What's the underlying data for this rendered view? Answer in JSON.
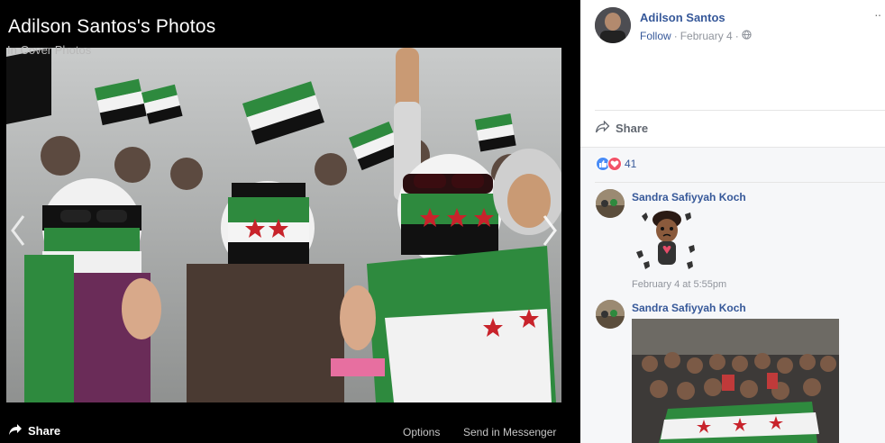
{
  "viewer": {
    "title": "Adilson Santos's Photos",
    "album": "In Cover Photos",
    "share_label": "Share",
    "options_label": "Options",
    "messenger_label": "Send in Messenger"
  },
  "post": {
    "owner_name": "Adilson Santos",
    "follow_label": "Follow",
    "separator": "·",
    "date": "February 4",
    "privacy_icon": "globe-icon",
    "more_label": "··",
    "share_label": "Share",
    "reaction_count": "41",
    "reaction_icons": [
      "like-icon",
      "love-icon"
    ]
  },
  "comments": [
    {
      "author": "Sandra Safiyyah Koch",
      "type": "sticker",
      "timestamp": "February 4 at 5:55pm"
    },
    {
      "author": "Sandra Safiyyah Koch",
      "type": "photo"
    }
  ],
  "colors": {
    "link": "#365899",
    "meta": "#90949c",
    "like": "#4a8cf6",
    "love": "#f25268",
    "flag_green": "#1f8a3a",
    "flag_red": "#d12a2a"
  }
}
